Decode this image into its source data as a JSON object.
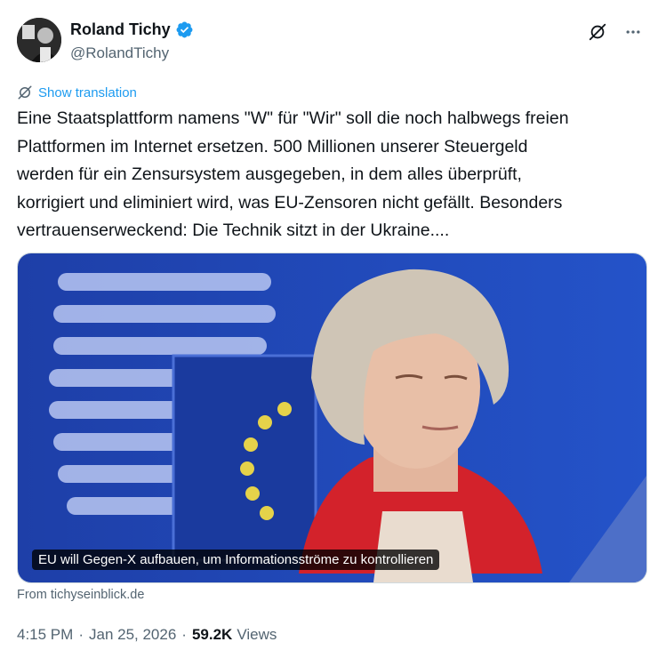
{
  "author": {
    "display_name": "Roland Tichy",
    "handle": "@RolandTichy",
    "verified": true
  },
  "actions": {
    "grok_icon": "grok-icon",
    "more_icon": "more-icon"
  },
  "translation": {
    "label": "Show translation"
  },
  "tweet": {
    "text": "Eine Staatsplattform namens \"W\" für \"Wir\" soll die noch halbwegs freien\nPlattformen im Internet ersetzen. 500 Millionen unserer Steuergeld\nwerden für ein Zensursystem ausgegeben, in dem alles überprüft,\nkorrigiert und  eliminiert wird, was EU-Zensoren nicht gefällt. Besonders\nvertrauenserweckend: Die Technik sitzt in der Ukraine...."
  },
  "card": {
    "caption": "EU will Gegen-X aufbauen, um Informationsströme zu kontrollieren",
    "source": "From tichyseinblick.de"
  },
  "meta": {
    "time": "4:15 PM",
    "date": "Jan 25, 2026",
    "views_count": "59.2K",
    "views_label": "Views"
  },
  "colors": {
    "accent": "#1d9bf0",
    "muted": "#536471",
    "text": "#0f1419",
    "photo_bg": "#1f47b8"
  }
}
